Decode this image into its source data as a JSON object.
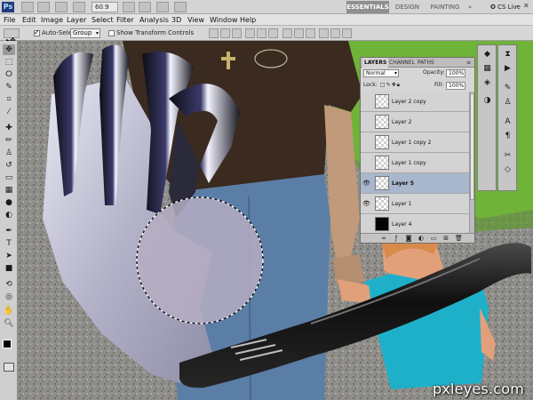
{
  "app": {
    "logo": "Ps",
    "zoom": "60.9",
    "workspaces": [
      "ESSENTIALS",
      "DESIGN",
      "PAINTING"
    ],
    "active_workspace": "ESSENTIALS",
    "cs_live": "CS Live",
    "window_buttons": [
      "–",
      "□",
      "✕"
    ]
  },
  "menu": [
    "File",
    "Edit",
    "Image",
    "Layer",
    "Select",
    "Filter",
    "Analysis",
    "3D",
    "View",
    "Window",
    "Help"
  ],
  "options": {
    "auto_select_label": "Auto-Select:",
    "auto_select_checked": true,
    "auto_select_value": "Group",
    "show_transform_label": "Show Transform Controls",
    "show_transform_checked": false
  },
  "tools": [
    {
      "icon": "move-icon",
      "glyph": "✥"
    },
    {
      "icon": "marquee-icon",
      "glyph": "⬚"
    },
    {
      "icon": "lasso-icon",
      "glyph": "ⵔ"
    },
    {
      "icon": "quick-select-icon",
      "glyph": "✎"
    },
    {
      "icon": "crop-icon",
      "glyph": "⌗"
    },
    {
      "icon": "eyedropper-icon",
      "glyph": "⁄"
    },
    {
      "icon": "healing-icon",
      "glyph": "✚"
    },
    {
      "icon": "brush-icon",
      "glyph": "✏"
    },
    {
      "icon": "clone-stamp-icon",
      "glyph": "♙"
    },
    {
      "icon": "history-brush-icon",
      "glyph": "↺"
    },
    {
      "icon": "eraser-icon",
      "glyph": "▭"
    },
    {
      "icon": "gradient-icon",
      "glyph": "▦"
    },
    {
      "icon": "blur-icon",
      "glyph": "●"
    },
    {
      "icon": "dodge-icon",
      "glyph": "◐"
    },
    {
      "icon": "pen-icon",
      "glyph": "✒"
    },
    {
      "icon": "type-icon",
      "glyph": "T"
    },
    {
      "icon": "path-select-icon",
      "glyph": "➤"
    },
    {
      "icon": "shape-icon",
      "glyph": "■"
    },
    {
      "icon": "3d-rotate-icon",
      "glyph": "⟲"
    },
    {
      "icon": "3d-orbit-icon",
      "glyph": "◎"
    },
    {
      "icon": "hand-icon",
      "glyph": "✋"
    },
    {
      "icon": "zoom-icon",
      "glyph": "🔍︎"
    }
  ],
  "layers_panel": {
    "tabs": [
      "LAYERS",
      "CHANNEL",
      "PATHS"
    ],
    "blend_mode": "Normal",
    "opacity_label": "Opacity:",
    "opacity_value": "100%",
    "lock_label": "Lock:",
    "fill_label": "Fill:",
    "fill_value": "100%",
    "layers": [
      {
        "name": "Layer 2 copy",
        "visible": false,
        "selected": false,
        "thumb": "transparent"
      },
      {
        "name": "Layer 2",
        "visible": false,
        "selected": false,
        "thumb": "transparent"
      },
      {
        "name": "Layer 1 copy 2",
        "visible": false,
        "selected": false,
        "thumb": "transparent"
      },
      {
        "name": "Layer 1 copy",
        "visible": false,
        "selected": false,
        "thumb": "transparent"
      },
      {
        "name": "Layer 5",
        "visible": true,
        "selected": true,
        "thumb": "transparent"
      },
      {
        "name": "Layer 1",
        "visible": true,
        "selected": false,
        "thumb": "transparent"
      },
      {
        "name": "Layer 4",
        "visible": false,
        "selected": false,
        "thumb": "black"
      }
    ],
    "footer_icons": [
      "link-icon",
      "fx-icon",
      "mask-icon",
      "adjustment-icon",
      "folder-icon",
      "new-layer-icon",
      "trash-icon"
    ]
  },
  "watermark": "pxleyes.com",
  "colors": {
    "ui_gray": "#d6d6d6",
    "selected_layer": "#a9b7cc",
    "shirt_tan": "#c9b98f",
    "shirt_brown": "#3a2a1f",
    "jeans": "#5b7ea6",
    "child_shirt": "#1fb0c9",
    "grass": "#6fb338"
  }
}
